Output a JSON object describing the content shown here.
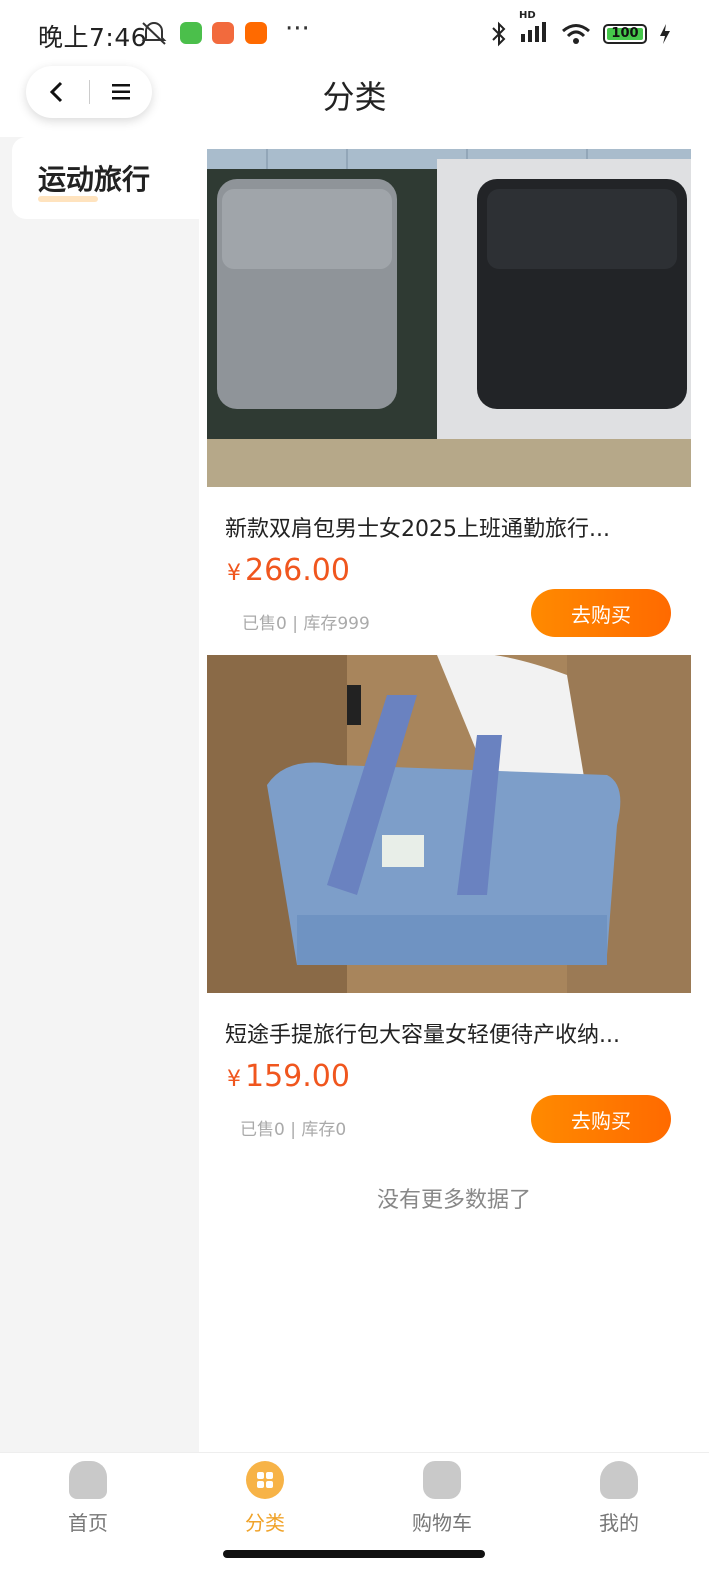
{
  "status_bar": {
    "time": "晚上7:46",
    "signal": "HD",
    "battery": "100"
  },
  "header": {
    "title": "分类",
    "back_icon": "chevron-left-icon",
    "menu_icon": "menu-icon"
  },
  "sidebar": {
    "items": [
      {
        "label": "运动旅行",
        "active": true
      }
    ]
  },
  "products": [
    {
      "name": "新款双肩包男士女2025上班通勤旅行...",
      "currency": "¥",
      "price": "266.00",
      "meta": "已售0 | 库存999",
      "buy_label": "去购买"
    },
    {
      "name": "短途手提旅行包大容量女轻便待产收纳...",
      "currency": "¥",
      "price": "159.00",
      "meta": "已售0 | 库存0",
      "buy_label": "去购买"
    }
  ],
  "no_more_text": "没有更多数据了",
  "tabbar": {
    "tabs": [
      {
        "label": "首页",
        "icon": "home-icon",
        "active": false
      },
      {
        "label": "分类",
        "icon": "category-icon",
        "active": true
      },
      {
        "label": "购物车",
        "icon": "cart-icon",
        "active": false
      },
      {
        "label": "我的",
        "icon": "profile-icon",
        "active": false
      }
    ]
  },
  "colors": {
    "accent": "#ff7a00",
    "price": "#f0561e",
    "active_tab": "#f0a32a"
  }
}
